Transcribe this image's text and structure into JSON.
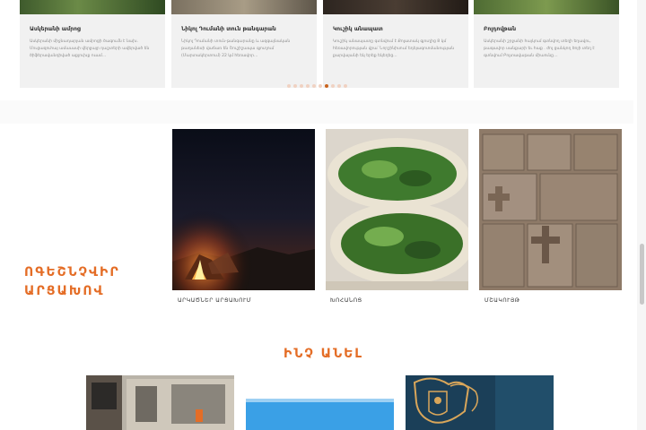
{
  "cards": [
    {
      "title": "Ասկերանի ամրոց",
      "desc": "Ասկերանի միջնադարյան ամրոցի ծագումն է նախ․ Մուցազուհայ ամաւասի վերջայր դաշտերի ավերված են ծիֆերավանդիված աքլուխք ուամ․․․"
    },
    {
      "title": "Նիկոլ Դումանի տուն թանգարան",
      "desc": "Նիկոլ Դումանի տուն-թանգարանը և ազգայնական թաղանեսի վաճառ են Շուշիշապա գյուղում (Մարտակերտում) 22 կմ հեռավոր․․․"
    },
    {
      "title": "Կուշիկ անապատ",
      "desc": "Կուշիկ անապատը գտնվում է Քոլատակ գյուղից 8 կմ հեռավորության վրա՝ Նորշինիսում եդեյագոտմանության քարվայանի եկ երեք եկեղեց․․․"
    },
    {
      "title": "Բոլդովթան",
      "desc": "Ասկերանի շրջանի հայկում գտնվող տեղի եղավու, թագավոր սանքարի եւ հաք ․ ժոլ ցանկող ծոյի տեղ է գտնվում Բոլտավաթան միաունը․․․"
    }
  ],
  "carousel": {
    "dot_count": 10,
    "active_index": 6
  },
  "promo": {
    "title_line1": "ՈԳԵՇՆՉՎԻՐ",
    "title_line2": "ԱՐՑԱԽՈՎ"
  },
  "tiles": [
    {
      "caption": "ԱՐԿԱԾՆԵՐ ԱՐՑԱԽՈՒՄ"
    },
    {
      "caption": "ԽՈՀԱՆՈՑ"
    },
    {
      "caption": "ՄՇԱԿՈՒՅԹ"
    }
  ],
  "what_section": {
    "title": "ԻՆՉ ԱՆԵԼ"
  },
  "colors": {
    "accent": "#e46d26",
    "card_bg": "#f1f1f1",
    "dot_active": "#c9641e",
    "dot_inactive": "#f0d2c2"
  }
}
